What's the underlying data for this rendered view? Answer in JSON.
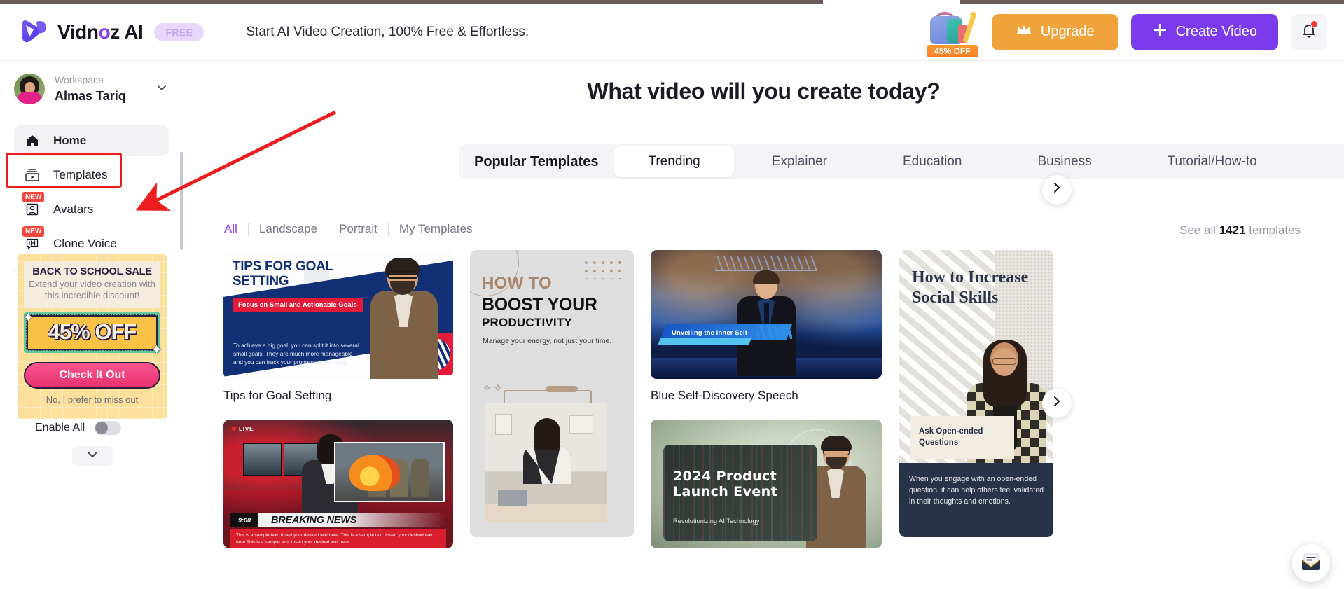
{
  "header": {
    "logo_text_pre": "Vidn",
    "logo_text_o": "o",
    "logo_text_post": "z AI",
    "logo_icon": "vidnoz-v-logo-icon",
    "free_badge": "FREE",
    "tagline": "Start AI Video Creation, 100% Free & Effortless.",
    "promo_pack_label": "45% OFF",
    "upgrade_label": "Upgrade",
    "upgrade_icon": "crown-icon",
    "upgrade_color": "#f1a33b",
    "create_label": "Create Video",
    "create_icon": "plus-icon",
    "create_color": "#7c3aed",
    "bell_icon": "bell-icon",
    "bell_has_dot": true
  },
  "sidebar": {
    "workspace_label": "Workspace",
    "workspace_name": "Almas Tariq",
    "workspace_chevron": "chevron-down-icon",
    "avatar_icon": "user-avatar",
    "items": [
      {
        "label": "Home",
        "icon": "home-icon",
        "active": true,
        "badge": ""
      },
      {
        "label": "Templates",
        "icon": "templates-icon",
        "active": false,
        "badge": ""
      },
      {
        "label": "Avatars",
        "icon": "avatar-person-icon",
        "active": false,
        "badge": "NEW"
      },
      {
        "label": "Clone Voice",
        "icon": "voice-wave-icon",
        "active": false,
        "badge": "NEW"
      }
    ],
    "promo": {
      "title": "BACK TO SCHOOL SALE",
      "subtitle": "Extend your video creation with this incredible discount!",
      "deal": "45% OFF",
      "cta": "Check It Out",
      "dismiss": "No, I prefer to miss out"
    },
    "enable_all_label": "Enable All",
    "enable_all_on": false,
    "collapse_icon": "chevron-down-icon"
  },
  "main": {
    "title": "What video will you create today?",
    "tabs": [
      {
        "label": "Popular Templates",
        "style": "bold"
      },
      {
        "label": "Trending",
        "style": "pill"
      },
      {
        "label": "Explainer",
        "style": "plain"
      },
      {
        "label": "Education",
        "style": "plain"
      },
      {
        "label": "Business",
        "style": "plain"
      },
      {
        "label": "Tutorial/How-to",
        "style": "plain"
      }
    ],
    "tabs_next_icon": "chevron-right-icon",
    "filters": [
      {
        "label": "All",
        "active": true
      },
      {
        "label": "Landscape",
        "active": false
      },
      {
        "label": "Portrait",
        "active": false
      },
      {
        "label": "My Templates",
        "active": false
      }
    ],
    "filter_active_color": "#8b3df2",
    "see_all_prefix": "See all",
    "see_all_count": "1421",
    "see_all_suffix": "templates",
    "cards_next_icon": "chevron-right-icon"
  },
  "cards": {
    "goal": {
      "title": "Tips for Goal Setting",
      "thumb_heading": "TIPS FOR GOAL SETTING",
      "thumb_tag": "Focus on Small and Actionable Goals",
      "thumb_body": "To achieve a big goal, you can split it into several small goals. They are much more manageable and you can track your progress more easily."
    },
    "boost": {
      "title": "",
      "thumb_line1": "HOW TO",
      "thumb_line2": "BOOST YOUR",
      "thumb_line3": "PRODUCTIVITY",
      "thumb_sub": "Manage your energy, not just your time."
    },
    "blue": {
      "title": "Blue Self-Discovery Speech",
      "thumb_ribbon": "Unveiling the Inner Self"
    },
    "social": {
      "title": "",
      "thumb_heading": "How to Increase Social Skills",
      "thumb_note": "Ask Open-ended Questions",
      "thumb_body": "When you engage with an open-ended question, it can help others feel validated in their thoughts and emotions."
    },
    "news": {
      "title": "",
      "live_label": "LIVE",
      "time": "9:00",
      "headline": "BREAKING NEWS",
      "ticker": "This is a sample text. Insert your desired text here. This is a sample text. Insert your desired text here.This is a sample text. Insert your desired text here."
    },
    "launch": {
      "title": "",
      "thumb_heading": "2024 Product Launch Event",
      "thumb_sub": "Revolutionizing AI Technology"
    }
  },
  "widgets": {
    "chat_icon": "chat-envelope-icon"
  },
  "annotation": {
    "type": "red-arrow",
    "color": "#ee1c1c",
    "points_to": "sidebar-item-templates",
    "highlight_box": "sidebar-item-templates"
  }
}
